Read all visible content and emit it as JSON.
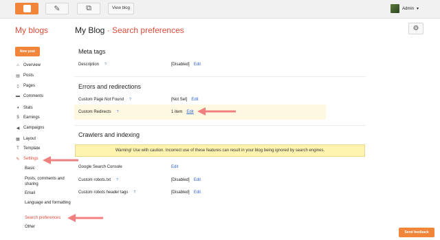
{
  "topbar": {
    "view_blog_label": "View blog",
    "admin_label": "Admin",
    "pencil_icon": "✎",
    "pages_icon": "⧉"
  },
  "header": {
    "my_blogs": "My blogs",
    "blog_name": "My Blog",
    "separator": "·",
    "page_name": "Search preferences",
    "gear_icon": "⚙"
  },
  "sidebar": {
    "new_post": "New post",
    "items": [
      {
        "label": "Overview",
        "icon": "⌂"
      },
      {
        "label": "Posts",
        "icon": "▤"
      },
      {
        "label": "Pages",
        "icon": "▯"
      },
      {
        "label": "Comments",
        "icon": "▬"
      },
      {
        "label": "Stats",
        "icon": "◕"
      },
      {
        "label": "Earnings",
        "icon": "$"
      },
      {
        "label": "Campaigns",
        "icon": "◀"
      },
      {
        "label": "Layout",
        "icon": "▦"
      },
      {
        "label": "Template",
        "icon": "T"
      },
      {
        "label": "Settings",
        "icon": "✎"
      }
    ],
    "settings_sub": [
      "Basic",
      "Posts, comments and sharing",
      "Email",
      "Language and formatting",
      "Search preferences",
      "Other"
    ]
  },
  "meta_tags": {
    "title": "Meta tags",
    "description_label": "Description",
    "description_value": "[Disabled]",
    "edit": "Edit",
    "help": "?"
  },
  "errors": {
    "title": "Errors and redirections",
    "not_found_label": "Custom Page Not Found",
    "not_found_value": "[Not Set]",
    "redirects_label": "Custom Redirects",
    "redirects_value": "1 item",
    "edit": "Edit",
    "help": "?"
  },
  "crawlers": {
    "title": "Crawlers and indexing",
    "warning": "Warning! Use with caution. Incorrect use of these features can result in your blog being ignored by search engines.",
    "gsc_label": "Google Search Console",
    "robots_label": "Custom robots.txt",
    "robots_value": "[Disabled]",
    "header_tags_label": "Custom robots header tags",
    "header_tags_value": "[Disabled]",
    "edit": "Edit",
    "help": "?"
  },
  "send_feedback": "Send feedback",
  "colors": {
    "accent": "#f1863a",
    "link": "#3367d6",
    "active": "#dd4b39",
    "annotation_arrow": "#f08080"
  }
}
